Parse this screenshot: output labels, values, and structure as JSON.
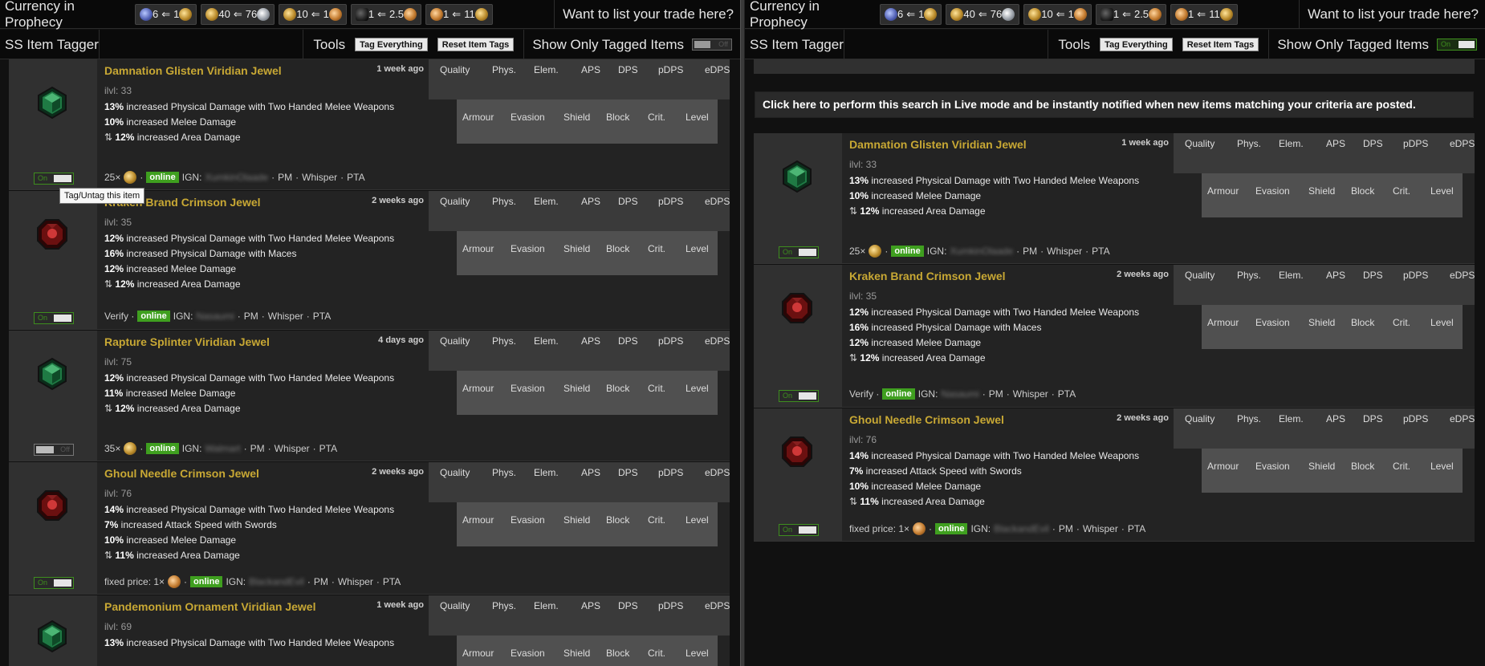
{
  "topbar": {
    "title": "Currency in Prophecy",
    "promo": "Want to list your trade here?",
    "rates": [
      {
        "left": "6",
        "arrow": "⇐",
        "right": "1",
        "li": "ci-blue",
        "ri": "ci-gold"
      },
      {
        "left": "40",
        "arrow": "⇐",
        "right": "76",
        "li": "ci-gold",
        "ri": "ci-silver"
      },
      {
        "left": "10",
        "arrow": "⇐",
        "right": "1",
        "li": "ci-gold",
        "ri": "ci-orange"
      },
      {
        "left": "1",
        "arrow": "⇐",
        "right": "2.5",
        "li": "ci-dark",
        "ri": "ci-orange"
      },
      {
        "left": "1",
        "arrow": "⇐",
        "right": "11",
        "li": "ci-orange",
        "ri": "ci-gold"
      }
    ]
  },
  "subbar": {
    "tagger": "SS Item Tagger",
    "tools": "Tools",
    "tag_everything": "Tag Everything",
    "reset_tags": "Reset Item Tags",
    "show_only": "Show Only Tagged Items",
    "toggle_on": "On",
    "toggle_off": "Off"
  },
  "stats": {
    "head": [
      "Quality",
      "Phys.",
      "Elem.",
      "APS",
      "DPS",
      "pDPS",
      "eDPS"
    ],
    "armour": [
      "Armour",
      "Evasion",
      "Shield",
      "Block",
      "Crit.",
      "Level"
    ]
  },
  "tooltip": "Tag/Untag this item",
  "live_banner": "Click here to perform this search in Live mode and be instantly notified when new items matching your criteria are posted.",
  "footer_common": {
    "pm": "PM",
    "whisper": "Whisper",
    "pta": "PTA",
    "online": "online",
    "ign": "IGN:",
    "sep": "·"
  },
  "left_items": [
    {
      "name": "Damnation Glisten Viridian Jewel",
      "ago": "1 week ago",
      "ilvl": "ilvl: 33",
      "color": "green",
      "tag": "On",
      "price": "25×",
      "seller": "XumkinOlaade",
      "mods": [
        {
          "v": "13%",
          "t": " increased Physical Damage with Two Handed Melee Weapons"
        },
        {
          "v": "10%",
          "t": " increased Melee Damage"
        },
        {
          "pre": "⇅ ",
          "v": "12%",
          "t": " increased Area Damage"
        }
      ]
    },
    {
      "name": "Kraken Brand Crimson Jewel",
      "ago": "2 weeks ago",
      "ilvl": "ilvl: 35",
      "color": "red",
      "tag": "On",
      "price": "Verify ·",
      "seller": "Nasaumi",
      "mods": [
        {
          "v": "12%",
          "t": " increased Physical Damage with Two Handed Melee Weapons"
        },
        {
          "v": "16%",
          "t": " increased Physical Damage with Maces"
        },
        {
          "v": "12%",
          "t": " increased Melee Damage"
        },
        {
          "pre": "⇅ ",
          "v": "12%",
          "t": " increased Area Damage"
        }
      ]
    },
    {
      "name": "Rapture Splinter Viridian Jewel",
      "ago": "4 days ago",
      "ilvl": "ilvl: 75",
      "color": "green",
      "tag": "Off",
      "price": "35×",
      "seller": "Walmart",
      "mods": [
        {
          "v": "12%",
          "t": " increased Physical Damage with Two Handed Melee Weapons"
        },
        {
          "v": "11%",
          "t": " increased Melee Damage"
        },
        {
          "pre": "⇅ ",
          "v": "12%",
          "t": " increased Area Damage"
        }
      ]
    },
    {
      "name": "Ghoul Needle Crimson Jewel",
      "ago": "2 weeks ago",
      "ilvl": "ilvl: 76",
      "color": "red",
      "tag": "On",
      "price": "fixed price: 1×",
      "seller": "BlackandEvil",
      "mods": [
        {
          "v": "14%",
          "t": " increased Physical Damage with Two Handed Melee Weapons"
        },
        {
          "v": "7%",
          "t": " increased Attack Speed with Swords"
        },
        {
          "v": "10%",
          "t": " increased Melee Damage"
        },
        {
          "pre": "⇅ ",
          "v": "11%",
          "t": " increased Area Damage"
        }
      ]
    },
    {
      "name": "Pandemonium Ornament Viridian Jewel",
      "ago": "1 week ago",
      "ilvl": "ilvl: 69",
      "color": "green",
      "tag": "On",
      "price": "",
      "seller": "",
      "mods": [
        {
          "v": "13%",
          "t": " increased Physical Damage with Two Handed Melee Weapons"
        }
      ]
    }
  ],
  "right_items": [
    {
      "name": "Damnation Glisten Viridian Jewel",
      "ago": "1 week ago",
      "ilvl": "ilvl: 33",
      "color": "green",
      "tag": "On",
      "price": "25×",
      "seller": "XumkinOlaade",
      "mods": [
        {
          "v": "13%",
          "t": " increased Physical Damage with Two Handed Melee Weapons"
        },
        {
          "v": "10%",
          "t": " increased Melee Damage"
        },
        {
          "pre": "⇅ ",
          "v": "12%",
          "t": " increased Area Damage"
        }
      ]
    },
    {
      "name": "Kraken Brand Crimson Jewel",
      "ago": "2 weeks ago",
      "ilvl": "ilvl: 35",
      "color": "red",
      "tag": "On",
      "price": "Verify ·",
      "seller": "Nasaumi",
      "mods": [
        {
          "v": "12%",
          "t": " increased Physical Damage with Two Handed Melee Weapons"
        },
        {
          "v": "16%",
          "t": " increased Physical Damage with Maces"
        },
        {
          "v": "12%",
          "t": " increased Melee Damage"
        },
        {
          "pre": "⇅ ",
          "v": "12%",
          "t": " increased Area Damage"
        }
      ]
    },
    {
      "name": "Ghoul Needle Crimson Jewel",
      "ago": "2 weeks ago",
      "ilvl": "ilvl: 76",
      "color": "red",
      "tag": "On",
      "price": "fixed price: 1×",
      "seller": "BlackandEvil",
      "mods": [
        {
          "v": "14%",
          "t": " increased Physical Damage with Two Handed Melee Weapons"
        },
        {
          "v": "7%",
          "t": " increased Attack Speed with Swords"
        },
        {
          "v": "10%",
          "t": " increased Melee Damage"
        },
        {
          "pre": "⇅ ",
          "v": "11%",
          "t": " increased Area Damage"
        }
      ]
    }
  ]
}
